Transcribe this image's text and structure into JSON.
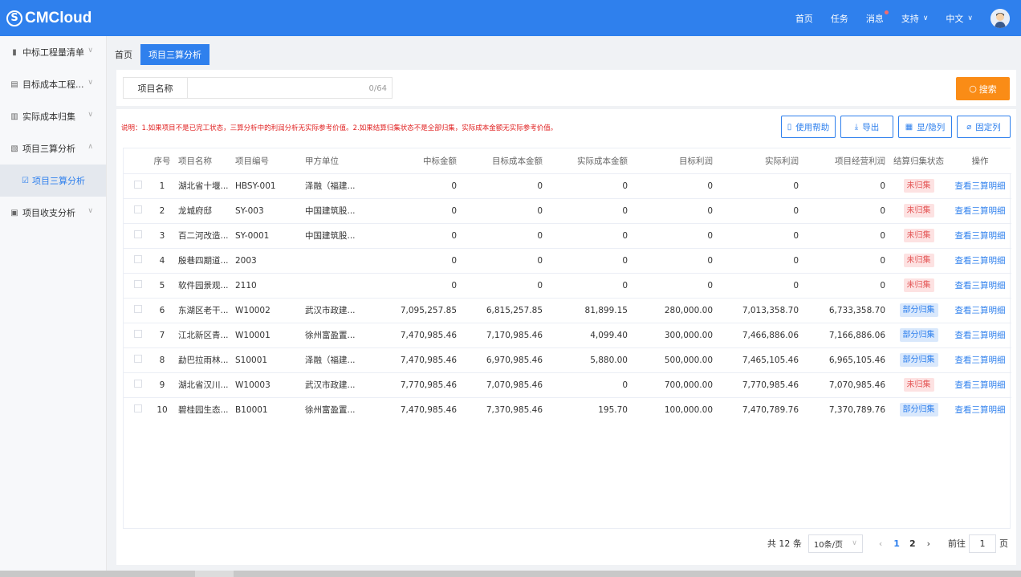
{
  "header": {
    "logo": "CMCloud",
    "nav": [
      {
        "label": "首页"
      },
      {
        "label": "任务"
      },
      {
        "label": "消息"
      },
      {
        "label": "支持"
      },
      {
        "label": "中文"
      }
    ]
  },
  "sidebar": {
    "items": [
      {
        "label": "中标工程量清单",
        "icon": "document-icon"
      },
      {
        "label": "目标成本工程...",
        "icon": "file-search-icon"
      },
      {
        "label": "实际成本归集",
        "icon": "ledger-icon"
      },
      {
        "label": "项目三算分析",
        "icon": "report-icon"
      },
      {
        "label": "项目收支分析",
        "icon": "wallet-icon"
      }
    ],
    "sub_item": {
      "label": "项目三算分析",
      "icon": "checklist-icon"
    }
  },
  "tabs": [
    {
      "label": "首页"
    },
    {
      "label": "项目三算分析"
    }
  ],
  "search": {
    "label": "项目名称",
    "value": "",
    "count": "0/64",
    "button": "搜索"
  },
  "notice": "说明：1.如果项目不是已完工状态，三算分析中的利润分析无实际参考价值。2.如果结算归集状态不是全部归集，实际成本金额无实际参考价值。",
  "toolbar": {
    "help": "使用帮助",
    "export": "导出",
    "columns": "显/隐列",
    "pin": "固定列"
  },
  "table": {
    "headers": [
      "序号",
      "项目名称",
      "项目编号",
      "甲方单位",
      "中标金额",
      "目标成本金额",
      "实际成本金额",
      "目标利润",
      "实际利润",
      "项目经营利润",
      "结算归集状态",
      "操作"
    ],
    "rows": [
      [
        "1",
        "湖北省十堰...",
        "HBSY-001",
        "泽融（福建...",
        "0",
        "0",
        "0",
        "0",
        "0",
        "0",
        "未归集",
        "查看三算明细"
      ],
      [
        "2",
        "龙城府邸",
        "SY-003",
        "中国建筑股...",
        "0",
        "0",
        "0",
        "0",
        "0",
        "0",
        "未归集",
        "查看三算明细"
      ],
      [
        "3",
        "百二河改造...",
        "SY-0001",
        "中国建筑股...",
        "0",
        "0",
        "0",
        "0",
        "0",
        "0",
        "未归集",
        "查看三算明细"
      ],
      [
        "4",
        "殷巷四期道...",
        "2003",
        "",
        "0",
        "0",
        "0",
        "0",
        "0",
        "0",
        "未归集",
        "查看三算明细"
      ],
      [
        "5",
        "软件园景观...",
        "2110",
        "",
        "0",
        "0",
        "0",
        "0",
        "0",
        "0",
        "未归集",
        "查看三算明细"
      ],
      [
        "6",
        "东湖区老干...",
        "W10002",
        "武汉市政建...",
        "7,095,257.85",
        "6,815,257.85",
        "81,899.15",
        "280,000.00",
        "7,013,358.70",
        "6,733,358.70",
        "部分归集",
        "查看三算明细"
      ],
      [
        "7",
        "江北新区青...",
        "W10001",
        "徐州富盈置...",
        "7,470,985.46",
        "7,170,985.46",
        "4,099.40",
        "300,000.00",
        "7,466,886.06",
        "7,166,886.06",
        "部分归集",
        "查看三算明细"
      ],
      [
        "8",
        "勐巴拉雨林...",
        "S10001",
        "泽融（福建...",
        "7,470,985.46",
        "6,970,985.46",
        "5,880.00",
        "500,000.00",
        "7,465,105.46",
        "6,965,105.46",
        "部分归集",
        "查看三算明细"
      ],
      [
        "9",
        "湖北省汉川...",
        "W10003",
        "武汉市政建...",
        "7,770,985.46",
        "7,070,985.46",
        "0",
        "700,000.00",
        "7,770,985.46",
        "7,070,985.46",
        "未归集",
        "查看三算明细"
      ],
      [
        "10",
        "碧桂园生态...",
        "B10001",
        "徐州富盈置...",
        "7,470,985.46",
        "7,370,985.46",
        "195.70",
        "100,000.00",
        "7,470,789.76",
        "7,370,789.76",
        "部分归集",
        "查看三算明细"
      ]
    ]
  },
  "pagination": {
    "total": "共 12 条",
    "page_size": "10条/页",
    "pages": [
      "1",
      "2"
    ],
    "current": "1",
    "goto_label": "前往",
    "goto_value": "1",
    "page_suffix": "页"
  },
  "colors": {
    "primary": "#2f80ed",
    "search_button": "#fa8c16",
    "notice": "#e02020"
  }
}
